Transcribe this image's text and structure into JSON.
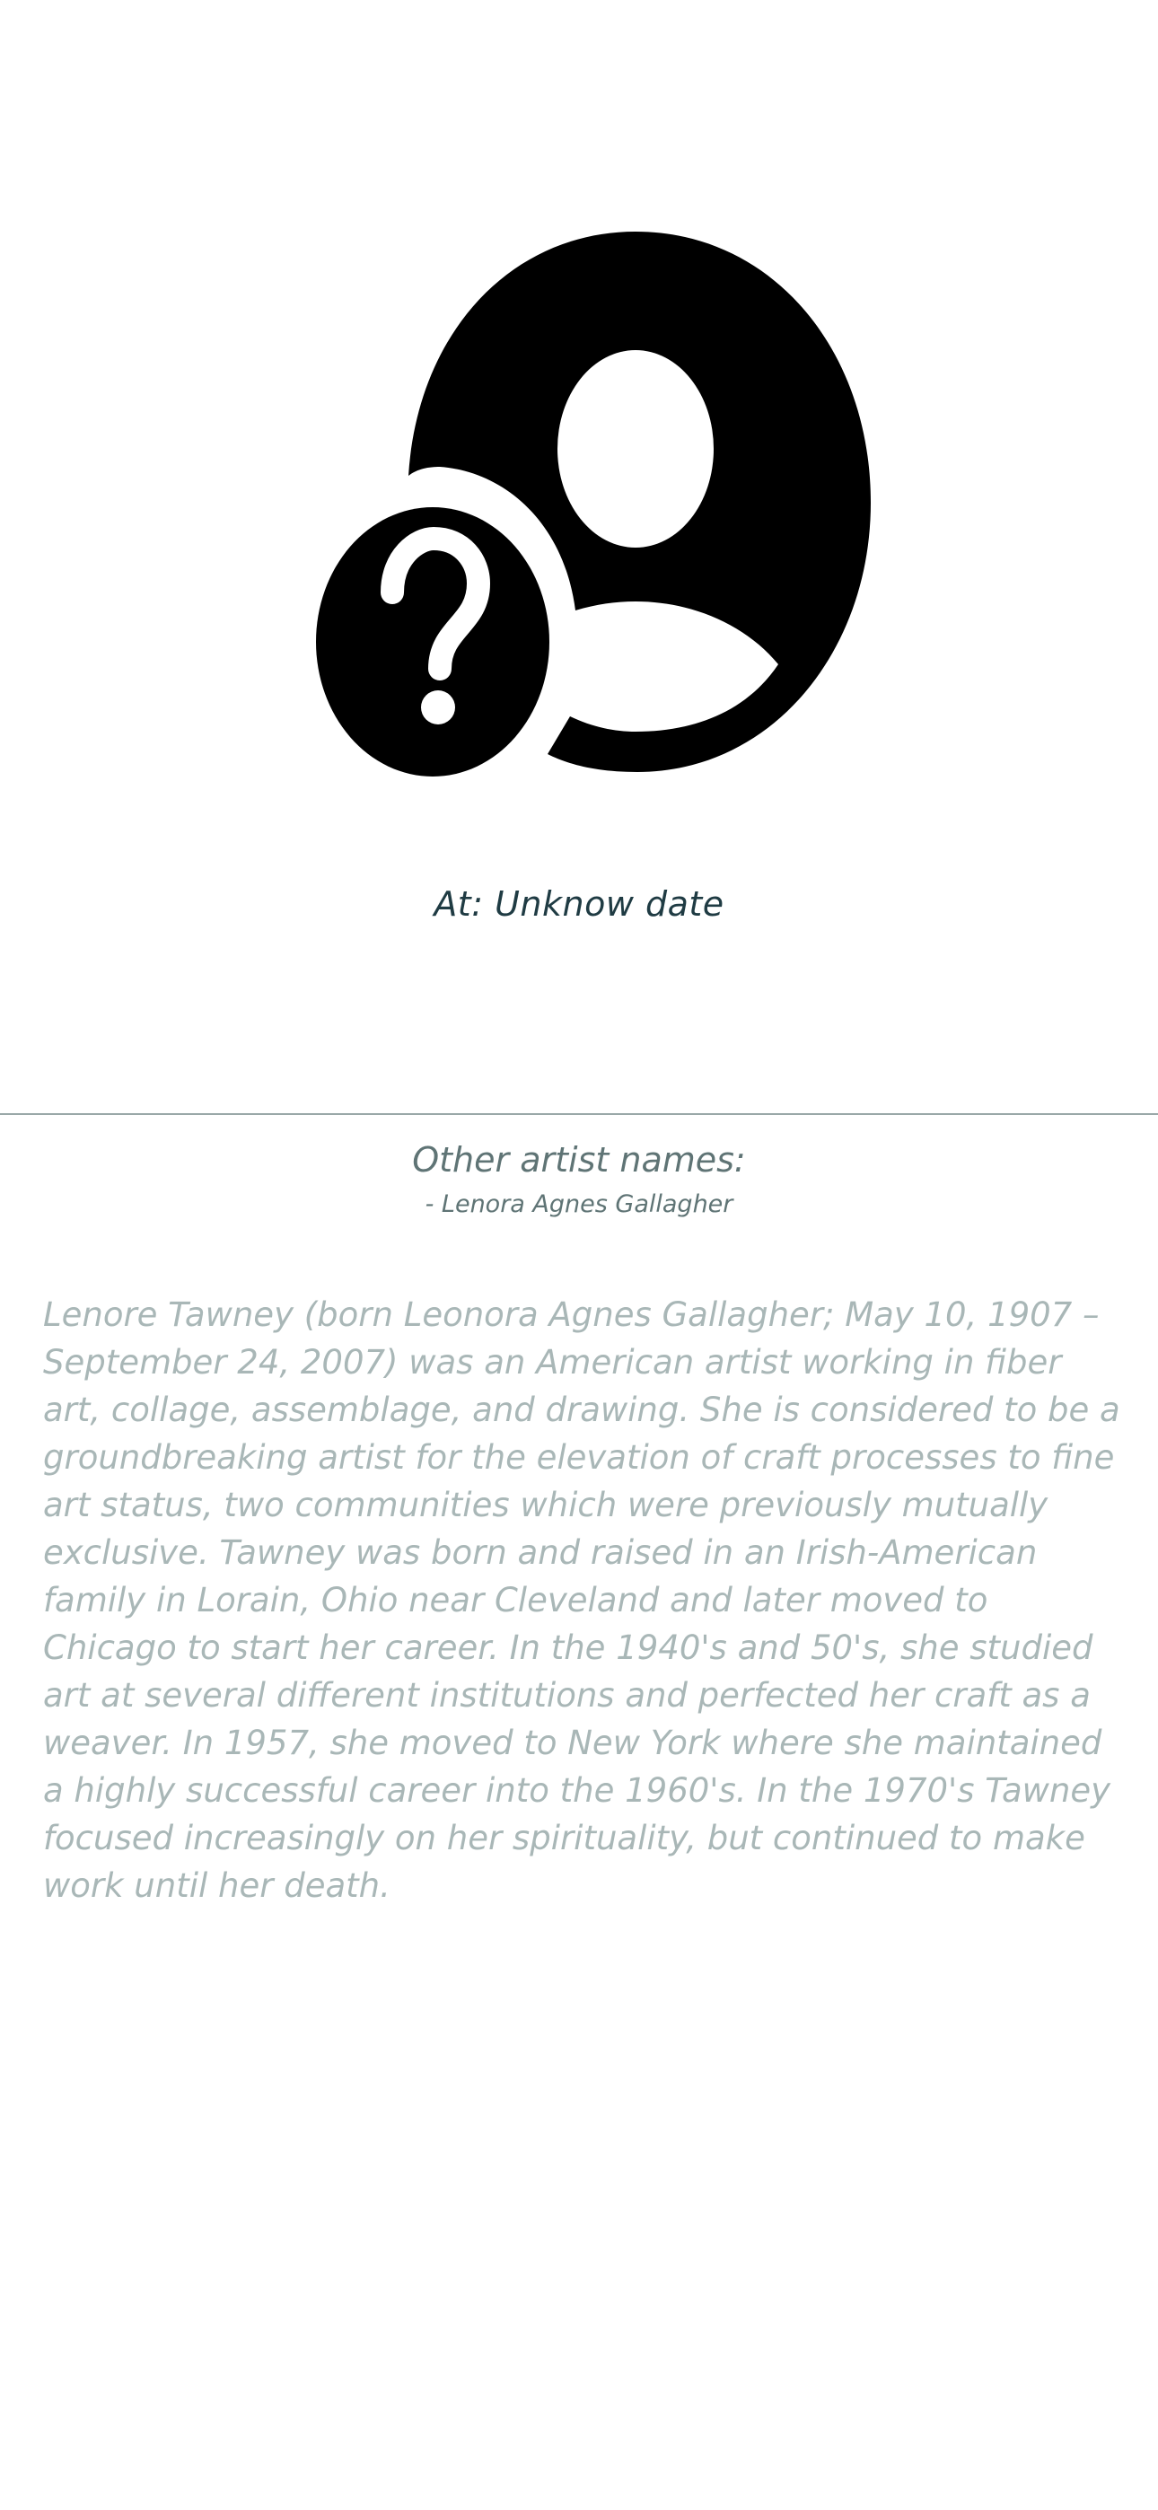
{
  "profile": {
    "avatar_icon": "unknown-person-question-icon",
    "date_text": "At: Unknow date"
  },
  "other_names": {
    "heading": "Other artist names:",
    "items": [
      "- Lenora Agnes Gallagher"
    ]
  },
  "bio": {
    "text": "Lenore Tawney (born Leonora Agnes Gallagher; May 10, 1907 – September 24, 2007) was an American artist working in fiber art, collage, assemblage, and drawing. She is considered to be a groundbreaking artist for the elevation of craft processes to fine art status, two communities which were previously mutually exclusive. Tawney was born and raised in an Irish-American family in Lorain, Ohio near Cleveland and later moved to Chicago to start her career. In the 1940's and 50's, she studied art at several different institutions and perfected her craft as a weaver. In 1957, she moved to New York where she maintained a highly successful career into the 1960's. In the 1970's Tawney focused increasingly on her spirituality, but continued to make work until her death."
  },
  "colors": {
    "icon": "#000000",
    "date": "#1f3b43",
    "heading": "#5f7475",
    "bio": "#a9b7b7",
    "divider": "#9aa8a8"
  }
}
